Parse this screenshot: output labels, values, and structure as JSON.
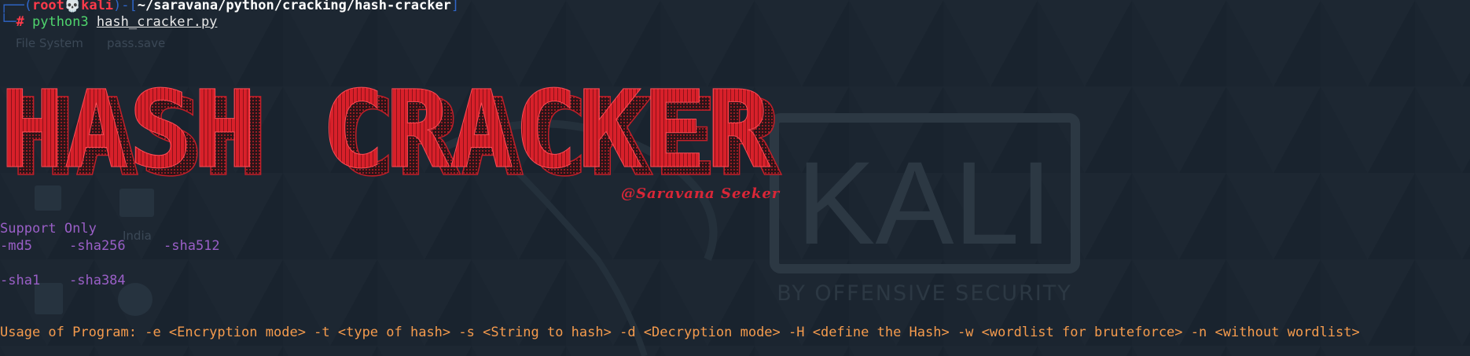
{
  "desktop": {
    "labels": [
      "File System",
      "pass.save",
      "India"
    ],
    "watermark": {
      "logo_text": "KALI",
      "tagline": "BY OFFENSIVE SECURITY"
    }
  },
  "terminal": {
    "prompt": {
      "tree_top": "┌──(",
      "user": "root",
      "skull": "💀",
      "host": "kali",
      "sep": ")-[",
      "path": "~/saravana/python/cracking/hash-cracker",
      "close": "]",
      "tree_bottom": "└─",
      "symbol": "#",
      "command": "python3",
      "argument": "hash_cracker.py"
    },
    "banner": {
      "title": "HASH CRACKER",
      "author": "@Saravana Seeker"
    },
    "support_heading": "Support Only",
    "hash_options_row1": [
      "-md5",
      "-sha256",
      "-sha512"
    ],
    "hash_options_row2": [
      "-sha1",
      "-sha384"
    ],
    "usage": "Usage of Program: -e <Encryption mode> -t <type of hash> -s <String to hash> -d <Decryption mode> -H <define the Hash> -w <wordlist for bruteforce> -n <without wordlist>"
  },
  "colors": {
    "background": "#1b2530",
    "banner_red": "#d8202a",
    "prompt_blue": "#2f66c9",
    "command_green": "#4fd56d",
    "purple_text": "#9a5fc7",
    "usage_orange": "#f59b4d"
  }
}
